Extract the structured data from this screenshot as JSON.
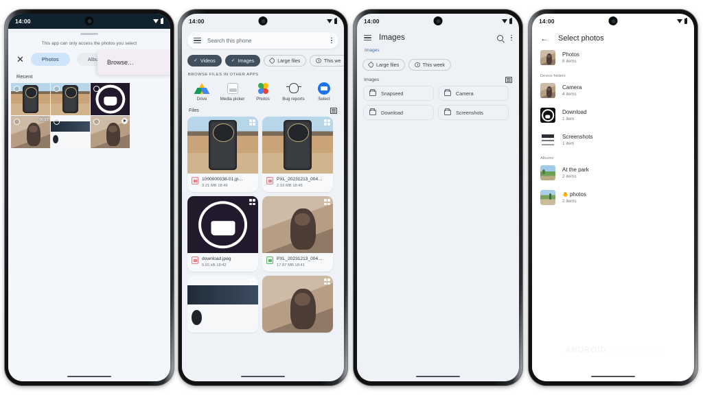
{
  "phone1": {
    "statusbar": {
      "time": "14:00",
      "wifi_icon": "wifi-icon",
      "battery_icon": "battery-icon"
    },
    "sheet_note": "This app can only access the photos you select",
    "close_label": "✕",
    "tabs": [
      {
        "label": "Photos",
        "selected": true
      },
      {
        "label": "Albums",
        "selected": false
      }
    ],
    "browse_popup": "Browse…",
    "recent_label": "Recent",
    "grid": [
      {
        "art": "th-phone",
        "badge": "",
        "selectable": true
      },
      {
        "art": "th-phone",
        "badge": "",
        "selectable": true
      },
      {
        "art": "th-droid",
        "badge": "",
        "selectable": true
      },
      {
        "art": "th-sel",
        "badge": "00:07",
        "selectable": true
      },
      {
        "art": "th-web",
        "badge": "",
        "selectable": true
      },
      {
        "art": "th-sel",
        "badge": "play",
        "selectable": true
      }
    ]
  },
  "phone2": {
    "statusbar": {
      "time": "14:00"
    },
    "search": {
      "placeholder": "Search this phone",
      "menu_icon": "hamburger-icon",
      "overflow_icon": "kebab-icon"
    },
    "chips": [
      {
        "label": "Videos",
        "selected": true,
        "icon": "check-icon"
      },
      {
        "label": "Images",
        "selected": true,
        "icon": "check-icon"
      },
      {
        "label": "Large files",
        "selected": false,
        "icon": "tag-icon"
      },
      {
        "label": "This we",
        "selected": false,
        "icon": "clock-icon"
      }
    ],
    "browse_caption": "BROWSE FILES IN OTHER APPS",
    "apps": [
      {
        "label": "Drive",
        "icon": "drive-icon"
      },
      {
        "label": "Media picker",
        "icon": "media-picker-icon"
      },
      {
        "label": "Photos",
        "icon": "google-photos-icon"
      },
      {
        "label": "Bug reports",
        "icon": "bug-icon"
      },
      {
        "label": "Select",
        "icon": "select-icon"
      }
    ],
    "files_header": {
      "label": "Files",
      "view_icon": "list-view-icon"
    },
    "files": [
      {
        "name": "1000000038-01.jp…",
        "meta": "3.21 MB 18:46",
        "type": "image",
        "art": "th-phone"
      },
      {
        "name": "PXL_20231213_004…",
        "meta": "2.93 MB 18:45",
        "type": "image",
        "art": "th-phone"
      },
      {
        "name": "download.jpeg",
        "meta": "5.65 kB 18:42",
        "type": "image",
        "art": "th-droid"
      },
      {
        "name": "PXL_20231213_004…",
        "meta": "17.87 MB 18:41",
        "type": "video",
        "art": "th-sel"
      },
      {
        "name": "",
        "meta": "",
        "type": "image",
        "art": "th-web"
      },
      {
        "name": "",
        "meta": "",
        "type": "image",
        "art": "th-sel"
      }
    ]
  },
  "phone3": {
    "statusbar": {
      "time": "14:00"
    },
    "title": "Images",
    "menu_icon": "hamburger-icon",
    "search_icon": "search-icon",
    "overflow_icon": "kebab-icon",
    "section_label": "Images",
    "chips": [
      {
        "label": "Large files",
        "icon": "tag-icon"
      },
      {
        "label": "This week",
        "icon": "clock-icon"
      }
    ],
    "list_header": {
      "label": "Images",
      "view_icon": "grid-view-icon"
    },
    "folders": [
      {
        "label": "Snapseed"
      },
      {
        "label": "Camera"
      },
      {
        "label": "Download"
      },
      {
        "label": "Screenshots"
      }
    ]
  },
  "phone4": {
    "statusbar": {
      "time": "14:00"
    },
    "back_icon": "back-arrow-icon",
    "title": "Select photos",
    "top_item": {
      "name": "Photos",
      "count": "8 items",
      "art": "th-sel"
    },
    "device_folders_label": "Device folders",
    "device_folders": [
      {
        "name": "Camera",
        "count": "4 items",
        "art": "th-sel"
      },
      {
        "name": "Download",
        "count": "1 item",
        "art": "th-dl"
      },
      {
        "name": "Screenshots",
        "count": "1 item",
        "art": "th-ss"
      }
    ],
    "albums_label": "Albums",
    "albums": [
      {
        "name": "At the park",
        "count": "2 items",
        "art": "th-park",
        "emoji": ""
      },
      {
        "name": "photos",
        "count": "2 items",
        "art": "th-photos",
        "emoji": "🐥"
      }
    ],
    "watermark": {
      "part1": "ANDROID",
      "part2": "AUTHORITY"
    }
  },
  "colors": {
    "accent_blue": "#1a73e8",
    "chip_selected": "#41505c",
    "photos_chip": "#cfe3fb",
    "screen_bg": "#eef1f5",
    "status_dark": "#10222e"
  }
}
